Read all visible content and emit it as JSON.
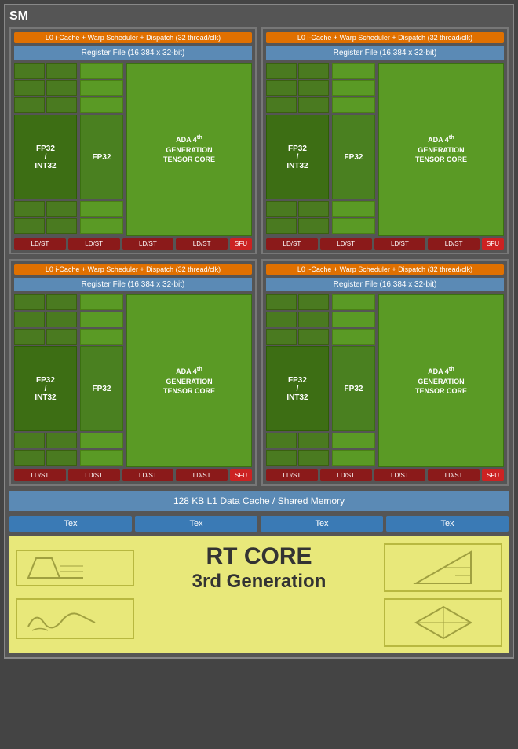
{
  "sm_title": "SM",
  "quadrants": [
    {
      "l0_label": "L0 i-Cache + Warp Scheduler + Dispatch (32 thread/clk)",
      "reg_label": "Register File (16,384 x 32-bit)",
      "fp32_int32_label": "FP32\n/\nINT32",
      "fp32_label": "FP32",
      "tensor_label": "ADA 4th\nGENERATION\nTENSOR CORE",
      "ldst_labels": [
        "LD/ST",
        "LD/ST",
        "LD/ST",
        "LD/ST"
      ],
      "sfu_label": "SFU"
    },
    {
      "l0_label": "L0 i-Cache + Warp Scheduler + Dispatch (32 thread/clk)",
      "reg_label": "Register File (16,384 x 32-bit)",
      "fp32_int32_label": "FP32\n/\nINT32",
      "fp32_label": "FP32",
      "tensor_label": "ADA 4th\nGENERATION\nTENSOR CORE",
      "ldst_labels": [
        "LD/ST",
        "LD/ST",
        "LD/ST",
        "LD/ST"
      ],
      "sfu_label": "SFU"
    },
    {
      "l0_label": "L0 i-Cache + Warp Scheduler + Dispatch (32 thread/clk)",
      "reg_label": "Register File (16,384 x 32-bit)",
      "fp32_int32_label": "FP32\n/\nINT32",
      "fp32_label": "FP32",
      "tensor_label": "ADA 4th\nGENERATION\nTENSOR CORE",
      "ldst_labels": [
        "LD/ST",
        "LD/ST",
        "LD/ST",
        "LD/ST"
      ],
      "sfu_label": "SFU"
    },
    {
      "l0_label": "L0 i-Cache + Warp Scheduler + Dispatch (32 thread/clk)",
      "reg_label": "Register File (16,384 x 32-bit)",
      "fp32_int32_label": "FP32\n/\nINT32",
      "fp32_label": "FP32",
      "tensor_label": "ADA 4th\nGENERATION\nTENSOR CORE",
      "ldst_labels": [
        "LD/ST",
        "LD/ST",
        "LD/ST",
        "LD/ST"
      ],
      "sfu_label": "SFU"
    }
  ],
  "l1_cache_label": "128 KB L1 Data Cache / Shared Memory",
  "tex_labels": [
    "Tex",
    "Tex",
    "Tex",
    "Tex"
  ],
  "rt_core_line1": "RT CORE",
  "rt_core_line2": "3rd Generation"
}
